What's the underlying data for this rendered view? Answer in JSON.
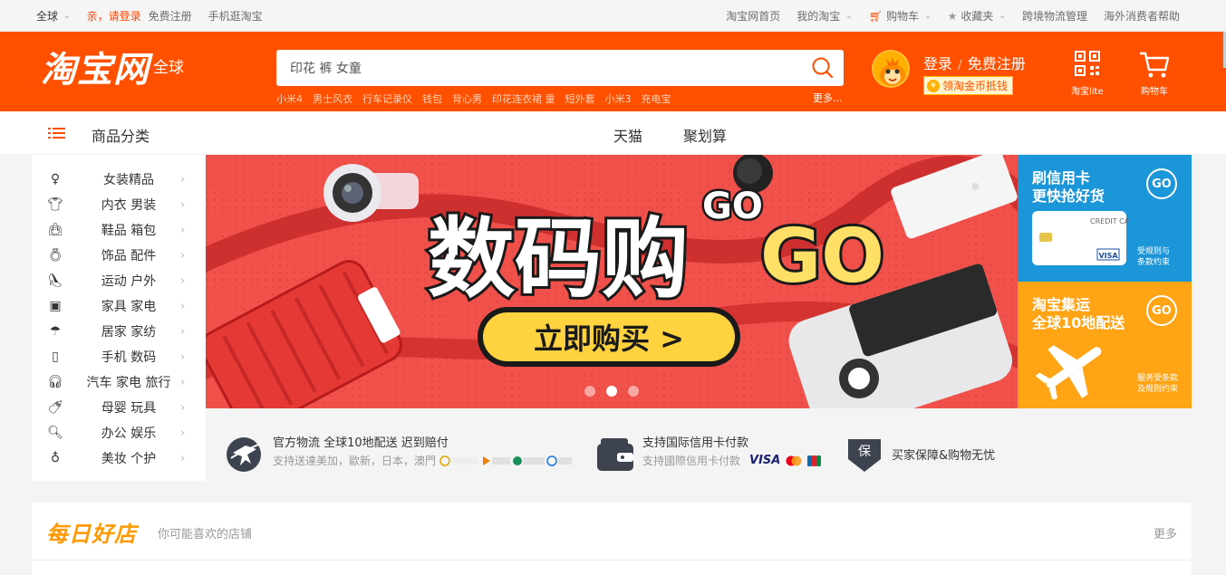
{
  "topbar": {
    "region": "全球",
    "login_prompt": "亲，请登录",
    "register": "免费注册",
    "mobile": "手机逛淘宝",
    "right_links": [
      "淘宝网首页",
      "我的淘宝",
      "购物车",
      "收藏夹",
      "跨境物流管理",
      "海外消费者帮助"
    ]
  },
  "header": {
    "logo_text": "淘宝网",
    "logo_sub": "全球",
    "search_value": "印花 裤 女童",
    "hot_words": [
      "小米4",
      "男士风衣",
      "行车记录仪",
      "钱包",
      "背心男",
      "印花连衣裙 童",
      "短外套",
      "小米3",
      "充电宝"
    ],
    "more": "更多...",
    "login": "登录",
    "register": "免费注册",
    "coin_label": "领淘金币抵钱",
    "taobao_lite": "淘宝lite",
    "cart": "购物车"
  },
  "nav": {
    "category_label": "商品分类",
    "tabs": [
      "天猫",
      "聚划算"
    ]
  },
  "categories": [
    {
      "label": "女装精品",
      "icon": "dress-icon"
    },
    {
      "label": "内衣 男装",
      "icon": "shirt-icon"
    },
    {
      "label": "鞋品 箱包",
      "icon": "bag-icon"
    },
    {
      "label": "饰品 配件",
      "icon": "ring-icon"
    },
    {
      "label": "运动 户外",
      "icon": "shoe-icon"
    },
    {
      "label": "家具 家电",
      "icon": "washer-icon"
    },
    {
      "label": "居家 家纺",
      "icon": "umbrella-icon"
    },
    {
      "label": "手机 数码",
      "icon": "phone-icon"
    },
    {
      "label": "汽车 家电 旅行",
      "icon": "headphone-icon"
    },
    {
      "label": "母婴 玩具",
      "icon": "bottle-icon"
    },
    {
      "label": "办公 娱乐",
      "icon": "magnifier-icon"
    },
    {
      "label": "美妆 个护",
      "icon": "perfume-icon"
    }
  ],
  "banner": {
    "headline": "数码购",
    "go": "GO",
    "cta": "立即购买 >",
    "slides": 3,
    "active_slide": 2
  },
  "side_promos": [
    {
      "title_line1": "刷信用卡",
      "title_line2": "更快抢好货",
      "go": "GO",
      "card_text": "CREDIT CARD",
      "card_brand": "VISA",
      "note1": "受规则与",
      "note2": "条款约束"
    },
    {
      "title_line1": "淘宝集运",
      "title_line2": "全球10地配送",
      "go": "GO",
      "note1": "服务受条款",
      "note2": "及规则约束"
    }
  ],
  "services": [
    {
      "title": "官方物流 全球10地配送 迟到赔付",
      "sub": "支持送達美加，歐新，日本，澳門",
      "icon": "plane-globe-icon"
    },
    {
      "title": "支持国际信用卡付款",
      "sub": "支持國際信用卡付款",
      "icon": "wallet-icon",
      "brands": [
        "VISA"
      ]
    },
    {
      "title": "买家保障&购物无忧",
      "sub": "",
      "icon": "shield-icon",
      "icon_char": "保"
    }
  ],
  "shops": {
    "title": "每日好店",
    "hint": "你可能喜欢的店铺",
    "more": "更多"
  },
  "colors": {
    "brand_orange": "#ff5000",
    "banner_red": "#f0524b",
    "promo_blue": "#1b96d9",
    "promo_orange": "#ffa415"
  }
}
